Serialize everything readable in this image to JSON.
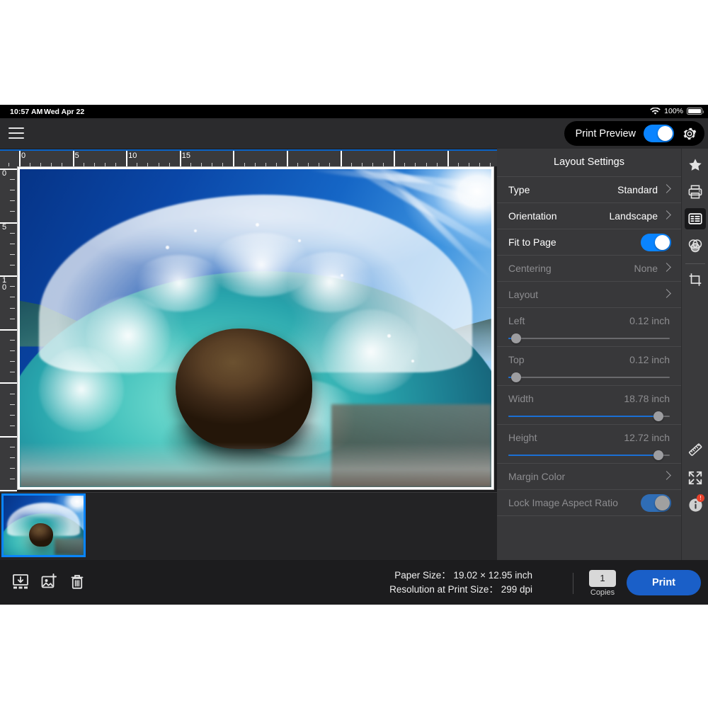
{
  "status_bar": {
    "time": "10:57 AM",
    "date": "Wed Apr 22",
    "battery_percent": "100%",
    "wifi_icon": "wifi-icon",
    "battery_icon": "battery-full-icon"
  },
  "toolbar": {
    "menu_icon": "hamburger-menu-icon",
    "print_preview_label": "Print Preview",
    "print_preview_enabled": true,
    "settings_icon": "gear-icon"
  },
  "ruler": {
    "unit_note": "inch",
    "horizontal_labels": [
      "0",
      "5",
      "10",
      "15"
    ],
    "vertical_labels": [
      "0",
      "5",
      "10"
    ]
  },
  "panel": {
    "title": "Layout Settings",
    "rows": [
      {
        "label": "Type",
        "value": "Standard",
        "control": "chevron",
        "disabled": false
      },
      {
        "label": "Orientation",
        "value": "Landscape",
        "control": "chevron",
        "disabled": false
      },
      {
        "label": "Fit to Page",
        "value": "",
        "control": "toggle",
        "toggle_on": true,
        "toggle_dimmed": false,
        "disabled": false
      },
      {
        "label": "Centering",
        "value": "None",
        "control": "chevron",
        "disabled": true
      },
      {
        "label": "Layout",
        "value": "",
        "control": "chevron",
        "disabled": true
      },
      {
        "label": "Left",
        "value": "0.12 inch",
        "control": "slider",
        "slider_percent": 2,
        "disabled": true
      },
      {
        "label": "Top",
        "value": "0.12 inch",
        "control": "slider",
        "slider_percent": 2,
        "disabled": true
      },
      {
        "label": "Width",
        "value": "18.78 inch",
        "control": "slider",
        "slider_percent": 96,
        "disabled": true
      },
      {
        "label": "Height",
        "value": "12.72 inch",
        "control": "slider",
        "slider_percent": 96,
        "disabled": true
      },
      {
        "label": "Margin Color",
        "value": "",
        "control": "chevron",
        "disabled": true
      },
      {
        "label": "Lock Image Aspect Ratio",
        "value": "",
        "control": "toggle",
        "toggle_on": true,
        "toggle_dimmed": true,
        "disabled": true
      }
    ]
  },
  "rail": {
    "items": [
      {
        "name": "favorites-star-icon",
        "active": false
      },
      {
        "name": "printer-icon",
        "active": false
      },
      {
        "name": "layout-settings-icon",
        "active": true
      },
      {
        "name": "color-balance-icon",
        "active": false
      },
      {
        "name": "crop-icon",
        "active": false
      },
      {
        "name": "ruler-icon",
        "active": false
      },
      {
        "name": "fullscreen-icon",
        "active": false
      },
      {
        "name": "info-icon",
        "active": false,
        "badge": "!"
      }
    ]
  },
  "filmstrip": {
    "thumbnail_selected": true,
    "thumbnail_name": "wave-photo-thumbnail"
  },
  "bottom_bar": {
    "save_icon": "save-to-sheet-icon",
    "add_image_icon": "add-image-icon",
    "delete_icon": "trash-icon",
    "paper_size_label": "Paper Size：",
    "paper_size_value": "19.02 × 12.95 inch",
    "resolution_label": "Resolution at Print Size：",
    "resolution_value": "299 dpi",
    "copies_value": "1",
    "copies_label": "Copies",
    "print_label": "Print"
  },
  "colors": {
    "accent_blue": "#0a84ff",
    "print_button_blue": "#1a5fc8",
    "panel_bg": "#38383a",
    "app_bg": "#1c1c1e",
    "toolbar_bg": "#2b2b2d",
    "badge_red": "#e8412b"
  }
}
